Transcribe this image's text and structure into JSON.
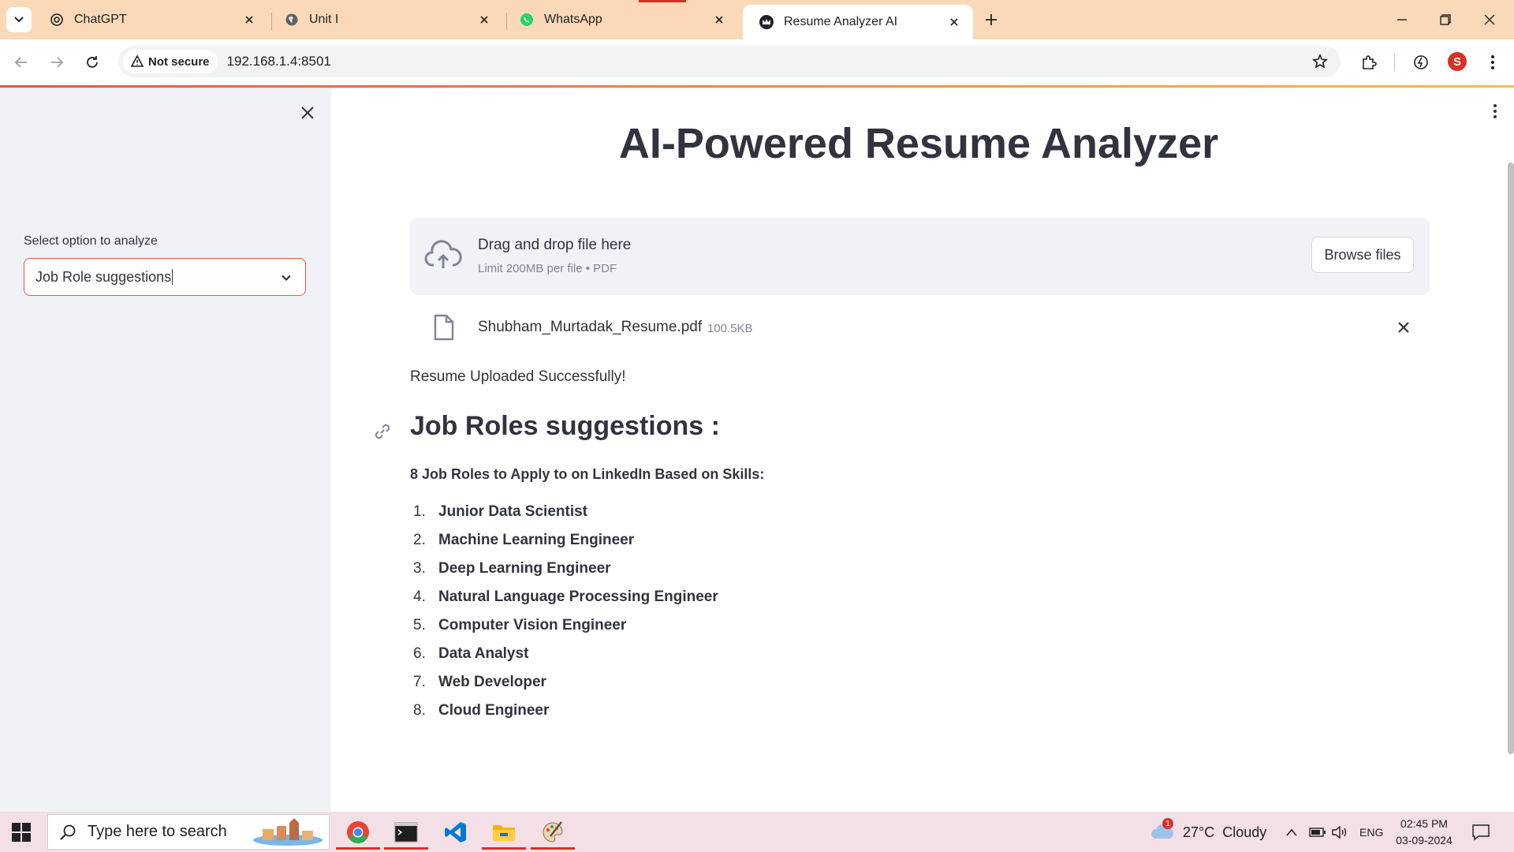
{
  "browser": {
    "tabs": [
      {
        "title": "ChatGPT",
        "icon": "chatgpt-icon",
        "active": false
      },
      {
        "title": "Unit I",
        "icon": "globe-icon",
        "active": false
      },
      {
        "title": "WhatsApp",
        "icon": "whatsapp-icon",
        "active": false
      },
      {
        "title": "Resume Analyzer AI",
        "icon": "streamlit-crown-icon",
        "active": true
      }
    ],
    "security_label": "Not secure",
    "url": "192.168.1.4:8501",
    "profile_initial": "S",
    "accent_colors": {
      "tabstrip": "#fbd9b8",
      "profile": "#d93025"
    }
  },
  "sidebar": {
    "select_label": "Select option to analyze",
    "select_value": "Job Role suggestions"
  },
  "main": {
    "title": "AI-Powered Resume Analyzer",
    "uploader": {
      "title": "Drag and drop file here",
      "subtitle": "Limit 200MB per file • PDF",
      "browse_label": "Browse files"
    },
    "file": {
      "name": "Shubham_Murtadak_Resume.pdf",
      "size": "100.5KB"
    },
    "success_message": "Resume Uploaded Successfully!",
    "section_heading": "Job Roles suggestions :",
    "subheading": "8 Job Roles to Apply to on LinkedIn Based on Skills:",
    "roles": [
      {
        "num": "1.",
        "name": "Junior Data Scientist"
      },
      {
        "num": "2.",
        "name": "Machine Learning Engineer"
      },
      {
        "num": "3.",
        "name": "Deep Learning Engineer"
      },
      {
        "num": "4.",
        "name": "Natural Language Processing Engineer"
      },
      {
        "num": "5.",
        "name": "Computer Vision Engineer"
      },
      {
        "num": "6.",
        "name": "Data Analyst"
      },
      {
        "num": "7.",
        "name": "Web Developer"
      },
      {
        "num": "8.",
        "name": "Cloud Engineer"
      }
    ]
  },
  "taskbar": {
    "search_placeholder": "Type here to search",
    "weather": "27°C  Cloudy",
    "weather_badge": "1",
    "language": "ENG",
    "time": "02:45 PM",
    "date": "03-09-2024"
  }
}
